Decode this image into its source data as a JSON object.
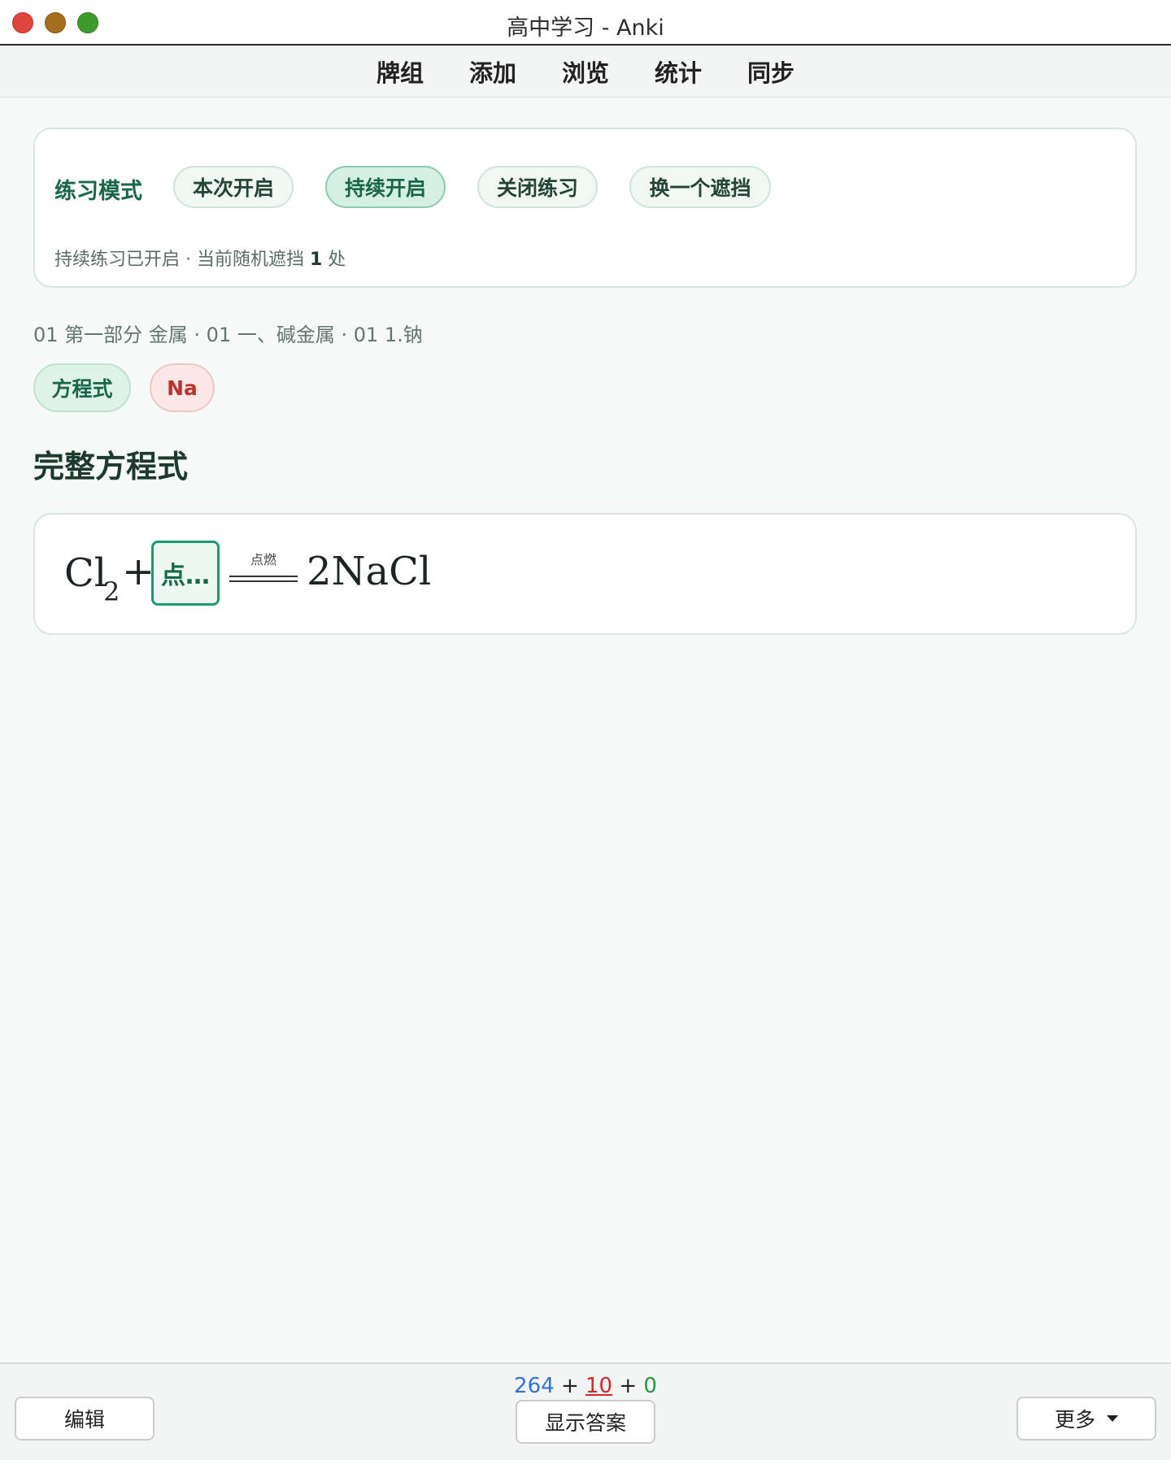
{
  "window": {
    "title": "高中学习 - Anki"
  },
  "nav": {
    "items": [
      "牌组",
      "添加",
      "浏览",
      "统计",
      "同步"
    ]
  },
  "practice": {
    "label": "练习模式",
    "buttons": [
      "本次开启",
      "持续开启",
      "关闭练习",
      "换一个遮挡"
    ],
    "active_button": "持续开启",
    "status_prefix": "持续练习已开启 · 当前随机遮挡",
    "status_count": "1",
    "status_suffix": "处"
  },
  "card": {
    "breadcrumb": "01 第一部分 金属 · 01 一、碱金属 · 01 1.钠",
    "tags": [
      "方程式",
      "Na"
    ],
    "section_title": "完整方程式",
    "equation": {
      "reactant": "Cl",
      "reactant_sub": "2",
      "plus": "+",
      "blank_text": "点…",
      "condition": "点燃",
      "product": "2NaCl"
    }
  },
  "bottom": {
    "count_new": "264",
    "count_learn": "10",
    "count_review": "0",
    "plus": "+",
    "edit_label": "编辑",
    "answer_label": "显示答案",
    "more_label": "更多"
  },
  "colors": {
    "accent": "#1f9a6a",
    "new": "#2f74d0",
    "learn": "#d0272a",
    "review": "#1f9b3f"
  }
}
